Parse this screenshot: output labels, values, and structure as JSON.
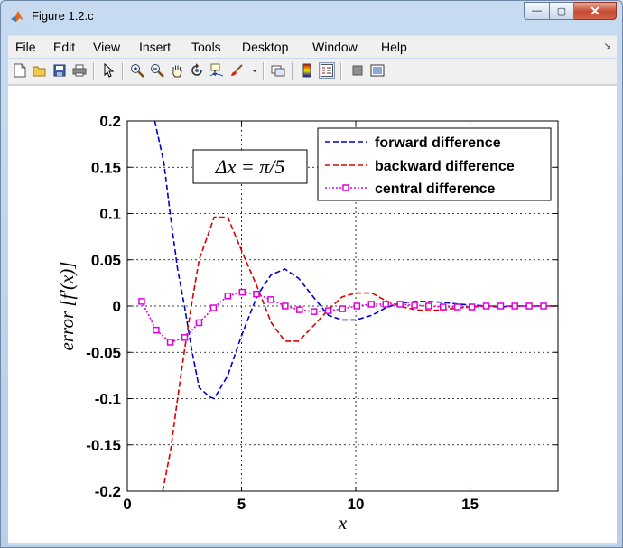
{
  "window": {
    "title": "Figure 1.2.c",
    "controls": {
      "minimize": "—",
      "maximize": "▢",
      "close": "✕"
    }
  },
  "menu": [
    "File",
    "Edit",
    "View",
    "Insert",
    "Tools",
    "Desktop",
    "Window",
    "Help"
  ],
  "toolbar": {
    "icons": [
      "new-figure-icon",
      "open-icon",
      "save-icon",
      "print-icon",
      "pointer-icon",
      "zoom-in-icon",
      "zoom-out-icon",
      "pan-icon",
      "rotate-icon",
      "data-cursor-icon",
      "brush-icon",
      "link-icon",
      "colorbar-icon",
      "legend-icon",
      "hide-tools-icon",
      "show-tools-icon"
    ]
  },
  "chart_data": {
    "type": "line",
    "xlabel": "x",
    "ylabel": "error [f′(x)]",
    "xlim": [
      0,
      18.85
    ],
    "ylim": [
      -0.2,
      0.2
    ],
    "xticks": [
      "0",
      "5",
      "10",
      "15"
    ],
    "xtick_values": [
      0,
      5,
      10,
      15
    ],
    "yticks": [
      "-0.2",
      "-0.15",
      "-0.1",
      "-0.05",
      "0",
      "0.05",
      "0.1",
      "0.15",
      "0.2"
    ],
    "ytick_values": [
      -0.2,
      -0.15,
      -0.1,
      -0.05,
      0,
      0.05,
      0.1,
      0.15,
      0.2
    ],
    "grid": true,
    "legend_position": "top-right",
    "annotation": "Δx = π/5",
    "colors": {
      "forward": "#0000cc",
      "backward": "#dd0000",
      "central": "#dd00dd"
    },
    "series": [
      {
        "name": "forward difference",
        "style": "dashed",
        "x": [
          1.2,
          1.6,
          1.9,
          2.2,
          2.5,
          2.8,
          3.14,
          3.6,
          3.8,
          4.4,
          5.0,
          5.7,
          6.3,
          6.9,
          7.5,
          8.2,
          8.8,
          9.4,
          10.0,
          10.7,
          11.3,
          11.9,
          12.6,
          13.2,
          13.8,
          14.5,
          15.1,
          15.7,
          16.3,
          17.0,
          17.6,
          18.2,
          18.85
        ],
        "y": [
          0.2,
          0.155,
          0.095,
          0.04,
          0.0,
          -0.045,
          -0.088,
          -0.098,
          -0.1,
          -0.075,
          -0.032,
          0.012,
          0.034,
          0.04,
          0.03,
          0.008,
          -0.01,
          -0.015,
          -0.015,
          -0.01,
          -0.002,
          0.003,
          0.005,
          0.005,
          0.004,
          0.002,
          0.001,
          0.0,
          -0.001,
          0.0,
          0.0,
          0.0,
          0.0
        ]
      },
      {
        "name": "backward difference",
        "style": "dashed",
        "x": [
          1.55,
          1.9,
          2.2,
          2.5,
          2.8,
          3.14,
          3.8,
          4.4,
          5.0,
          5.7,
          6.3,
          6.9,
          7.5,
          8.2,
          8.8,
          9.4,
          10.0,
          10.7,
          11.3,
          11.9,
          12.6,
          13.2,
          13.8,
          14.5,
          15.1,
          15.7,
          16.3,
          17.0,
          17.6,
          18.2,
          18.85
        ],
        "y": [
          -0.2,
          -0.155,
          -0.1,
          -0.048,
          0.0,
          0.05,
          0.096,
          0.096,
          0.06,
          0.02,
          -0.018,
          -0.038,
          -0.038,
          -0.02,
          -0.004,
          0.01,
          0.014,
          0.014,
          0.006,
          0.0,
          -0.004,
          -0.005,
          -0.004,
          -0.002,
          -0.001,
          0.0,
          0.0,
          0.0,
          0.0,
          0.0,
          0.0
        ]
      },
      {
        "name": "central difference",
        "style": "dotted-square",
        "x": [
          0.63,
          1.26,
          1.88,
          2.51,
          3.14,
          3.77,
          4.4,
          5.03,
          5.65,
          6.28,
          6.91,
          7.54,
          8.17,
          8.8,
          9.42,
          10.05,
          10.68,
          11.31,
          11.94,
          12.57,
          13.19,
          13.82,
          14.45,
          15.08,
          15.71,
          16.34,
          16.96,
          17.59,
          18.22
        ],
        "y": [
          0.005,
          -0.026,
          -0.039,
          -0.034,
          -0.018,
          -0.002,
          0.011,
          0.015,
          0.013,
          0.007,
          0.0,
          -0.004,
          -0.006,
          -0.005,
          -0.003,
          0.0,
          0.002,
          0.002,
          0.002,
          0.001,
          0.0,
          -0.001,
          -0.001,
          -0.001,
          0.0,
          0.0,
          0.0,
          0.0,
          0.0
        ]
      }
    ]
  }
}
